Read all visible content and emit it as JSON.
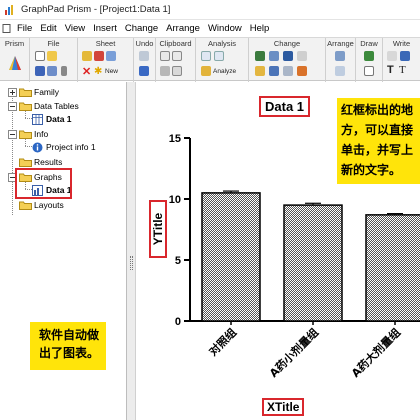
{
  "window": {
    "title": "GraphPad Prism - [Project1:Data 1]"
  },
  "menubar": [
    "File",
    "Edit",
    "View",
    "Insert",
    "Change",
    "Arrange",
    "Window",
    "Help"
  ],
  "ribbon": {
    "groups": [
      "Prism",
      "File",
      "Sheet",
      "Undo",
      "Clipboard",
      "Analysis",
      "Change",
      "Arrange",
      "Draw",
      "Write"
    ],
    "new_label": "New",
    "analyze_label": "Analyze"
  },
  "navigator": {
    "family": "Family",
    "data_tables": "Data Tables",
    "data_table_item": "Data 1",
    "info": "Info",
    "info_item": "Project info 1",
    "results": "Results",
    "graphs": "Graphs",
    "graph_item": "Data 1",
    "layouts": "Layouts"
  },
  "callouts": {
    "navigator_note": [
      "软件自动做",
      "出了图表。"
    ],
    "title_note": [
      "红框标出的地",
      "方，可以直接",
      "单击，并写上",
      "新的文字。"
    ]
  },
  "colors": {
    "highlight_red": "#d9272d",
    "callout_yellow": "#ffe40a"
  },
  "chart_data": {
    "type": "bar",
    "title": "Data 1",
    "xlabel": "XTitle",
    "ylabel": "YTitle",
    "ylim": [
      0,
      15
    ],
    "yticks": [
      "0",
      "5",
      "10",
      "15"
    ],
    "categories": [
      "对照组",
      "A药小剂量组",
      "A药大剂量组"
    ],
    "values": [
      10.5,
      9.5,
      8.7
    ],
    "errors": [
      0.15,
      0.15,
      0.1
    ]
  }
}
